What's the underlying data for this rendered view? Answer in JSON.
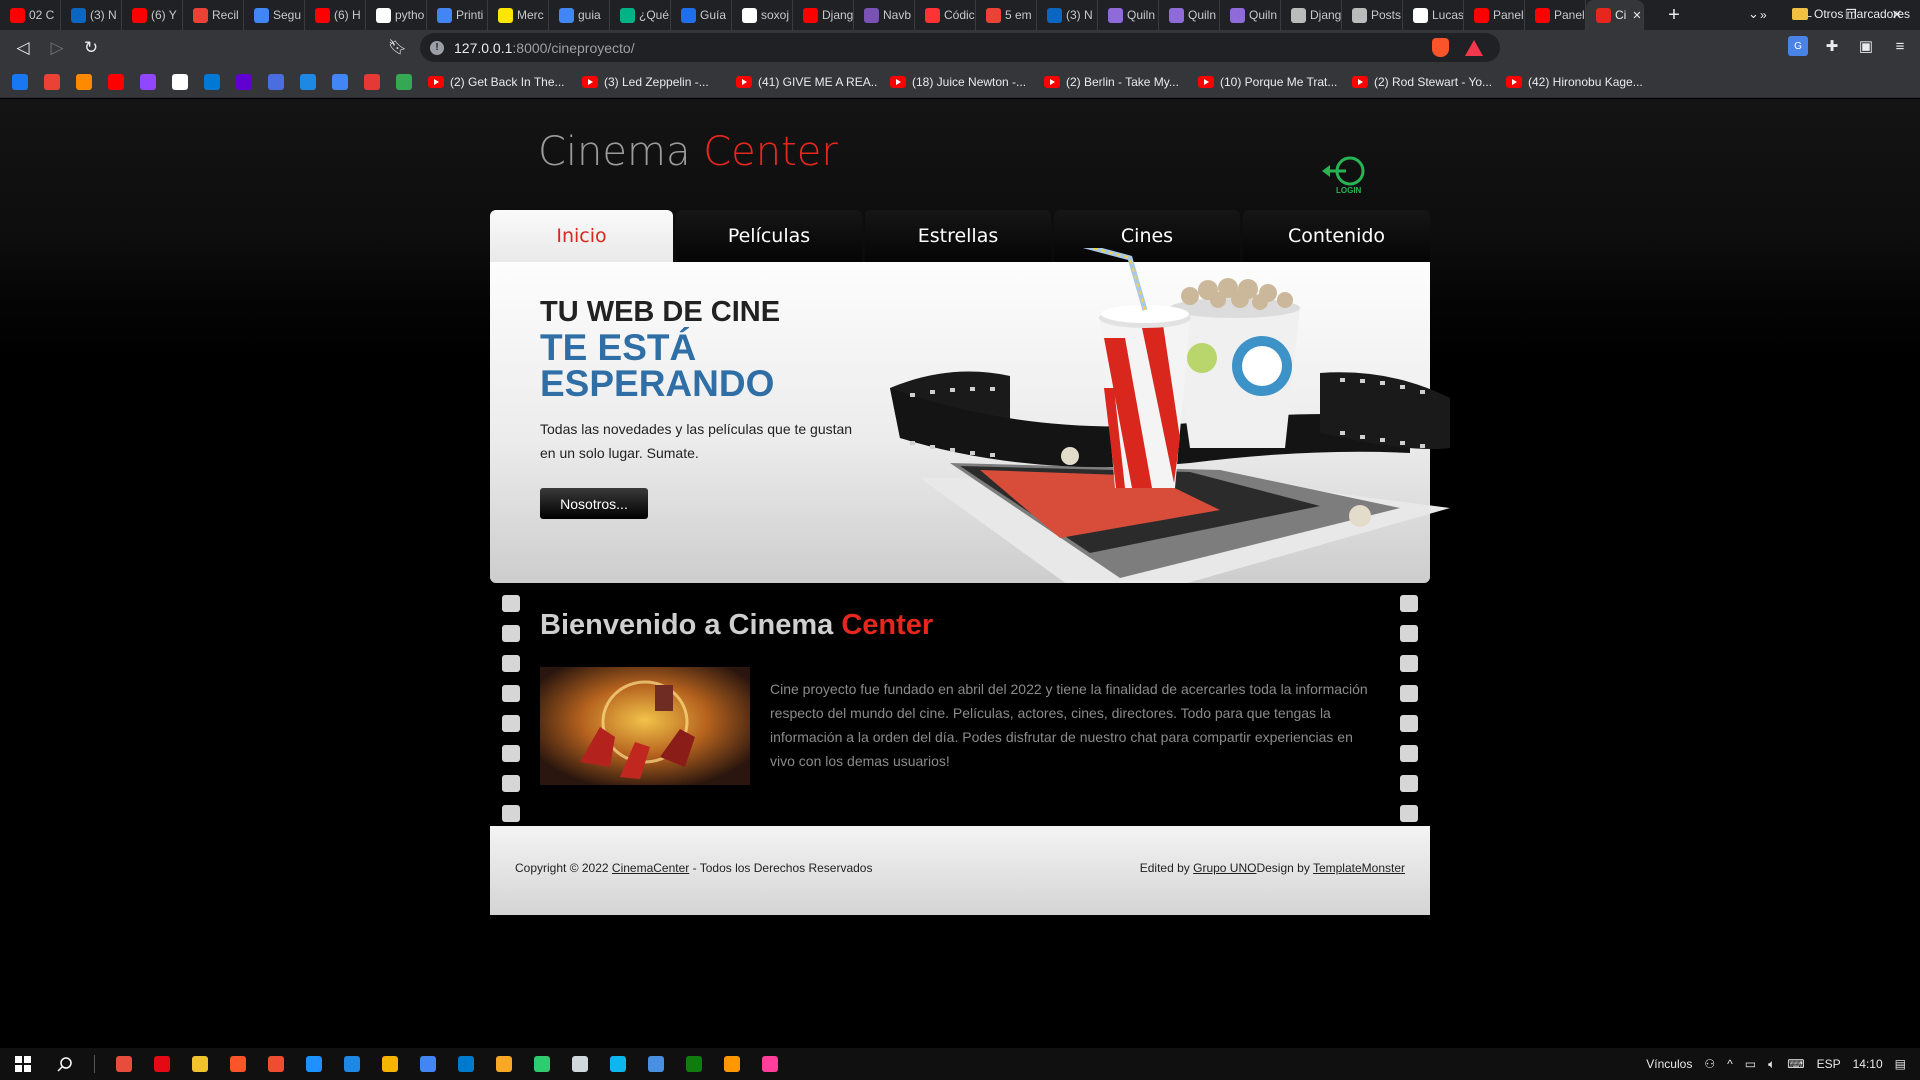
{
  "browser": {
    "tabs": [
      {
        "title": "02 C",
        "color": "#ff0000"
      },
      {
        "title": "(3) N",
        "color": "#0a66c2"
      },
      {
        "title": "(6) Y",
        "color": "#ff0000"
      },
      {
        "title": "Recil",
        "color": "#ea4335"
      },
      {
        "title": "Segu",
        "color": "#4285f4"
      },
      {
        "title": "(6) H",
        "color": "#ff0000"
      },
      {
        "title": "pytho",
        "color": "#ffffff"
      },
      {
        "title": "Printi",
        "color": "#4285f4"
      },
      {
        "title": "Merc",
        "color": "#ffe600"
      },
      {
        "title": "guia",
        "color": "#4285f4"
      },
      {
        "title": "¿Qué",
        "color": "#00b386"
      },
      {
        "title": "Guía",
        "color": "#1f6feb"
      },
      {
        "title": "soxoj",
        "color": "#ffffff"
      },
      {
        "title": "Djang",
        "color": "#ff0000"
      },
      {
        "title": "Navb",
        "color": "#7952b3"
      },
      {
        "title": "Códic",
        "color": "#ff3333"
      },
      {
        "title": "5 em",
        "color": "#ea4335"
      },
      {
        "title": "(3) N",
        "color": "#0a66c2"
      },
      {
        "title": "Quiln",
        "color": "#8e6bd8"
      },
      {
        "title": "Quiln",
        "color": "#8e6bd8"
      },
      {
        "title": "Quiln",
        "color": "#8e6bd8"
      },
      {
        "title": "Djang",
        "color": "#bbbbbb"
      },
      {
        "title": "Posts",
        "color": "#bbbbbb"
      },
      {
        "title": "Lucas",
        "color": "#ffffff"
      },
      {
        "title": "Panel",
        "color": "#ff0000"
      },
      {
        "title": "Panel",
        "color": "#ff0000"
      }
    ],
    "active_tab": {
      "title": "Ci",
      "color": "#e7261d"
    },
    "url_host": "127.0.0.1",
    "url_path": ":8000/cineproyecto/",
    "bookmarks": [
      "(2) Get Back In The...",
      "(3) Led Zeppelin -...",
      "(41) GIVE ME A REA...",
      "(18) Juice Newton -...",
      "(2) Berlin - Take My...",
      "(10) Porque Me Trat...",
      "(2) Rod Stewart - Yo...",
      "(42) Hironobu Kage..."
    ],
    "bookmark_icon_colors": [
      "#1877f2",
      "#ea4335",
      "#ff8a00",
      "#ff0000",
      "#9146ff",
      "#ffffff",
      "#0078d4",
      "#6001d2",
      "#4a6ee0",
      "#1e88e5",
      "#4285f4",
      "#e53935",
      "#34a853"
    ],
    "bookmarks_more": "»",
    "other_bookmarks": "Otros marcadores"
  },
  "site": {
    "logo_word1": "Cinema",
    "logo_word2": "Center",
    "login_label": "LOGIN",
    "nav": [
      "Inicio",
      "Películas",
      "Estrellas",
      "Cines",
      "Contenido"
    ],
    "hero": {
      "line1": "TU WEB DE CINE",
      "line2": "TE ESTÁ ESPERANDO",
      "text": "Todas las novedades y las películas que te gustan en un solo lugar. Sumate.",
      "button": "Nosotros..."
    },
    "welcome_prefix": "Bienvenido a Cinema ",
    "welcome_highlight": "Center",
    "about": "Cine proyecto fue fundado en abril del 2022 y tiene la finalidad de acercarles toda la información respecto del mundo del cine. Películas, actores, cines, directores. Todo para que tengas la información a la orden del día. Podes disfrutar de nuestro chat para compartir experiencias en vivo con los demas usuarios!",
    "footer": {
      "copyright_prefix": "Copyright © 2022 ",
      "copyright_link": "CinemaCenter",
      "copyright_suffix": " - Todos los Derechos Reservados",
      "edited_prefix": "Edited by ",
      "edited_link": "Grupo UNO",
      "design_prefix": "Design by ",
      "design_link": "TemplateMonster"
    },
    "colors": {
      "accent_red": "#e7261d",
      "accent_blue": "#2f6fa5",
      "login_green": "#27b454"
    }
  },
  "taskbar": {
    "icon_colors": [
      "#e74c3c",
      "#e50914",
      "#f2c12e",
      "#fb542b",
      "#ef4d2f",
      "#1e90ff",
      "#1e88e5",
      "#f4b400",
      "#4285f4",
      "#007acc",
      "#f9a825",
      "#2ecc71",
      "#cfd8dc",
      "#0db7ed",
      "#4a90e2",
      "#107c10",
      "#ff9800",
      "#ff3d9a"
    ],
    "links_label": "Vínculos",
    "lang": "ESP",
    "time": "14:10"
  }
}
